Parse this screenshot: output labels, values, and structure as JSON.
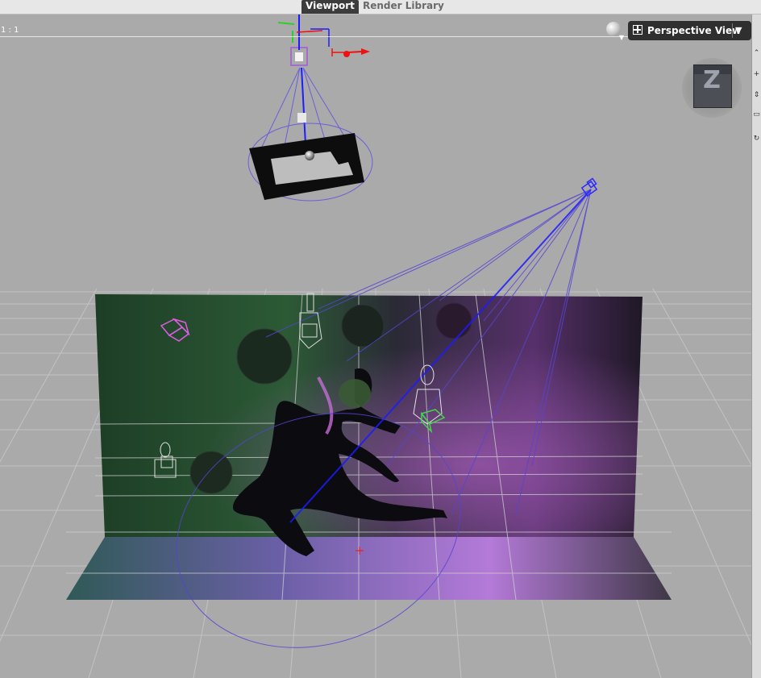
{
  "tabs": [
    {
      "label": "Viewport",
      "active": true
    },
    {
      "label": "Render Library",
      "active": false
    }
  ],
  "viewport": {
    "aspect_ratio_label": "1 : 1",
    "view_selector": {
      "label": "Perspective View",
      "icon": "viewport-layout-icon",
      "dropdown_icon": "chevron-down-icon"
    },
    "display_style_icon": "sphere-shading-icon",
    "view_cube_label": "Z"
  },
  "colors": {
    "viewport_bg": "#aaaaaa",
    "tab_active_bg": "#3c3c3c",
    "light_wire": "#5b4fd6",
    "spot_wire_pink": "#d55ad8",
    "backdrop_green": "#1d4a2d",
    "backdrop_purple": "#7a3c8d"
  },
  "right_toolbar_icons": [
    "scroll-up-icon",
    "plus-icon",
    "scroll-icon",
    "lock-icon",
    "rotate-icon"
  ]
}
